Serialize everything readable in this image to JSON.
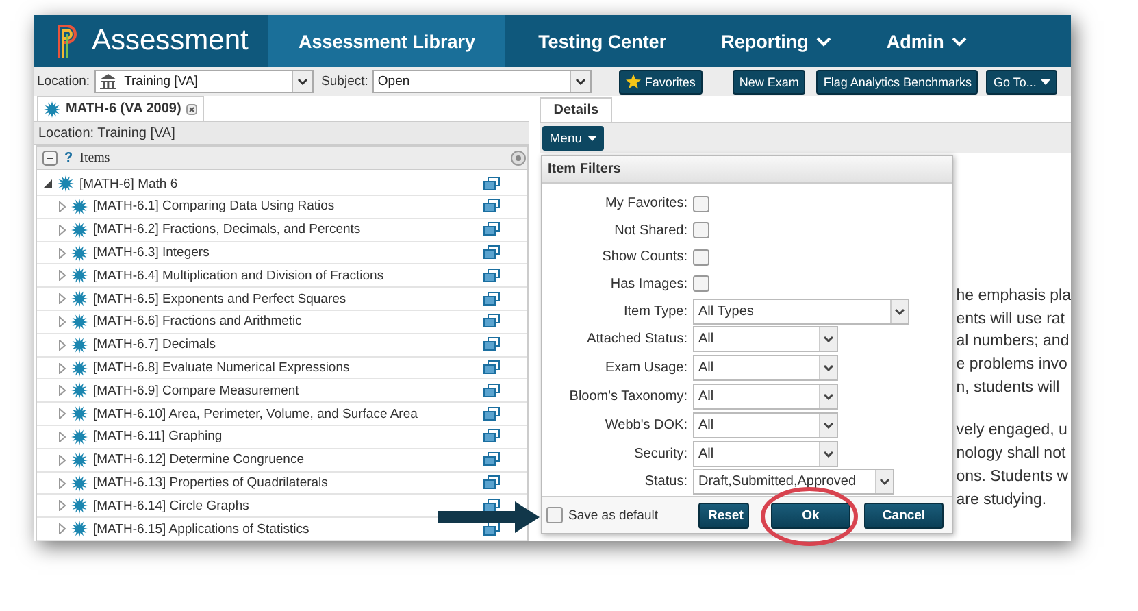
{
  "header": {
    "logo_text": "Assessment",
    "nav": [
      {
        "label": "Assessment Library",
        "selected": true,
        "dropdown": false
      },
      {
        "label": "Testing Center",
        "selected": false,
        "dropdown": false
      },
      {
        "label": "Reporting",
        "selected": false,
        "dropdown": true
      },
      {
        "label": "Admin",
        "selected": false,
        "dropdown": true
      }
    ]
  },
  "toolbar": {
    "location_label": "Location:",
    "location_value": "Training [VA]",
    "subject_label": "Subject:",
    "subject_value": "Open",
    "buttons": [
      {
        "label": "Favorites",
        "kind": "starred"
      },
      {
        "label": "New Exam",
        "kind": "plain"
      },
      {
        "label": "Flag Analytics Benchmarks",
        "kind": "plain"
      },
      {
        "label": "Go To...",
        "kind": "dropdown"
      }
    ]
  },
  "left_panel": {
    "tabs": [
      {
        "label": "MATH-6 (VA 2009)",
        "selected": true
      }
    ],
    "location": "Location: Training [VA]",
    "tree_help": "?",
    "tree_header": "Items",
    "tree": [
      {
        "label": "[MATH-6] Math 6",
        "expanded": true,
        "children": [
          {
            "label": "[MATH-6.1] Comparing Data Using Ratios",
            "expanded": false
          },
          {
            "label": "[MATH-6.2] Fractions, Decimals, and Percents",
            "expanded": false
          },
          {
            "label": "[MATH-6.3] Integers",
            "expanded": false
          },
          {
            "label": "[MATH-6.4] Multiplication and Division of Fractions",
            "expanded": false
          },
          {
            "label": "[MATH-6.5] Exponents and Perfect Squares",
            "expanded": false
          },
          {
            "label": "[MATH-6.6] Fractions and Arithmetic",
            "expanded": false
          },
          {
            "label": "[MATH-6.7] Decimals",
            "expanded": false
          },
          {
            "label": "[MATH-6.8] Evaluate Numerical Expressions",
            "expanded": false
          },
          {
            "label": "[MATH-6.9] Compare Measurement",
            "expanded": false
          },
          {
            "label": "[MATH-6.10] Area, Perimeter, Volume, and Surface Area",
            "expanded": false
          },
          {
            "label": "[MATH-6.11] Graphing",
            "expanded": false
          },
          {
            "label": "[MATH-6.12] Determine Congruence",
            "expanded": false
          },
          {
            "label": "[MATH-6.13] Properties of Quadrilaterals",
            "expanded": false
          },
          {
            "label": "[MATH-6.14] Circle Graphs",
            "expanded": false
          },
          {
            "label": "[MATH-6.15] Applications of Statistics",
            "expanded": false
          }
        ]
      }
    ]
  },
  "right_panel": {
    "tabs": [
      {
        "label": "Details",
        "selected": true
      }
    ],
    "menu_button": "Menu",
    "paragraphs": [
      [
        "he emphasis pla",
        "ents will use rat",
        "al numbers; and",
        "e problems invo",
        "n, students will"
      ],
      [
        "vely engaged, u",
        "nology shall not",
        "ons. Students w",
        "are studying."
      ]
    ]
  },
  "dialog": {
    "title": "Item Filters",
    "checkboxes": [
      {
        "label": "My Favorites:",
        "checked": false
      },
      {
        "label": "Not Shared:",
        "checked": false
      },
      {
        "label": "Show Counts:",
        "checked": false
      },
      {
        "label": "Has Images:",
        "checked": false
      }
    ],
    "selects": [
      {
        "label": "Item Type:",
        "value": "All Types"
      },
      {
        "label": "Attached Status:",
        "value": "All"
      },
      {
        "label": "Exam Usage:",
        "value": "All"
      },
      {
        "label": "Bloom's Taxonomy:",
        "value": "All"
      },
      {
        "label": "Webb's DOK:",
        "value": "All"
      },
      {
        "label": "Security:",
        "value": "All"
      },
      {
        "label": "Status:",
        "value": "Draft,Submitted,Approved"
      }
    ],
    "save_default": {
      "label": "Save as default",
      "checked": false
    },
    "buttons": [
      "Reset",
      "Ok",
      "Cancel"
    ]
  }
}
